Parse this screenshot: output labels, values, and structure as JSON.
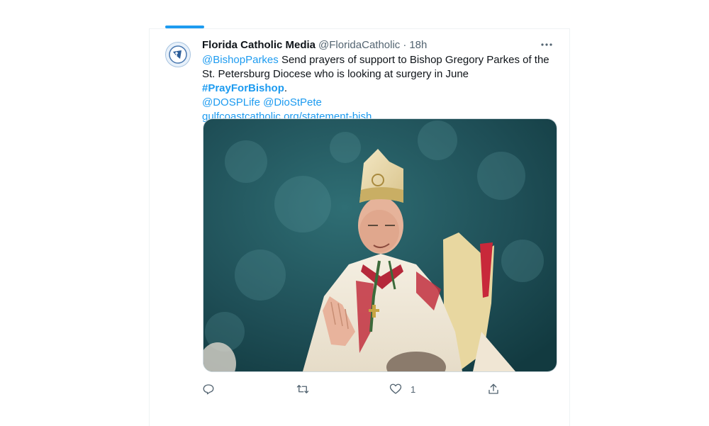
{
  "tweet": {
    "display_name": "Florida Catholic Media",
    "handle": "@FloridaCatholic",
    "separator": "·",
    "time": "18h",
    "mention_parkes": "@BishopParkes",
    "body_main": " Send prayers of support to Bishop Gregory Parkes of the St. Petersburg Diocese who is looking at surgery in June ",
    "hashtag": "#PrayForBishop",
    "body_end": ".",
    "mention_dosp": "@DOSPLife",
    "mention_dio": "@DioStPete",
    "link_text": "gulfcoastcatholic.org/statement-bish…",
    "like_count": "1",
    "icons": {
      "avatar": "florida-catholic-logo",
      "more": "more-icon",
      "reply": "reply-icon",
      "retweet": "retweet-icon",
      "like": "heart-icon",
      "share": "share-icon"
    },
    "colors": {
      "accent": "#1d9bf0",
      "secondary_text": "#536471",
      "primary_text": "#0f1419"
    }
  }
}
